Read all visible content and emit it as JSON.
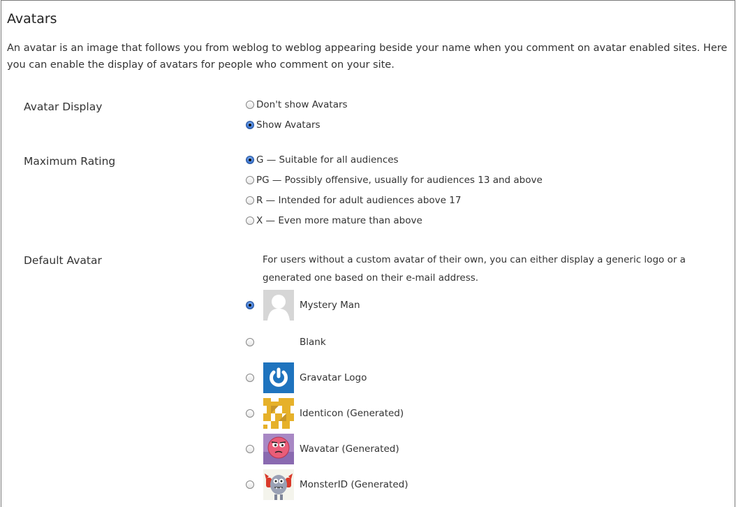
{
  "section": {
    "title": "Avatars",
    "intro": "An avatar is an image that follows you from weblog to weblog appearing beside your name when you comment on avatar enabled sites. Here you can enable the display of avatars for people who comment on your site."
  },
  "avatar_display": {
    "label": "Avatar Display",
    "options": [
      {
        "label": "Don't show Avatars",
        "checked": false
      },
      {
        "label": "Show Avatars",
        "checked": true
      }
    ]
  },
  "maximum_rating": {
    "label": "Maximum Rating",
    "options": [
      {
        "label": "G — Suitable for all audiences",
        "checked": true
      },
      {
        "label": "PG — Possibly offensive, usually for audiences 13 and above",
        "checked": false
      },
      {
        "label": "R — Intended for adult audiences above 17",
        "checked": false
      },
      {
        "label": "X — Even more mature than above",
        "checked": false
      }
    ]
  },
  "default_avatar": {
    "label": "Default Avatar",
    "description": "For users without a custom avatar of their own, you can either display a generic logo or a generated one based on their e-mail address.",
    "options": [
      {
        "label": "Mystery Man",
        "icon": "mystery-man-icon",
        "checked": true
      },
      {
        "label": "Blank",
        "icon": "blank-icon",
        "checked": false
      },
      {
        "label": "Gravatar Logo",
        "icon": "gravatar-logo-icon",
        "checked": false
      },
      {
        "label": "Identicon (Generated)",
        "icon": "identicon-icon",
        "checked": false
      },
      {
        "label": "Wavatar (Generated)",
        "icon": "wavatar-icon",
        "checked": false
      },
      {
        "label": "MonsterID (Generated)",
        "icon": "monsterid-icon",
        "checked": false
      }
    ]
  }
}
